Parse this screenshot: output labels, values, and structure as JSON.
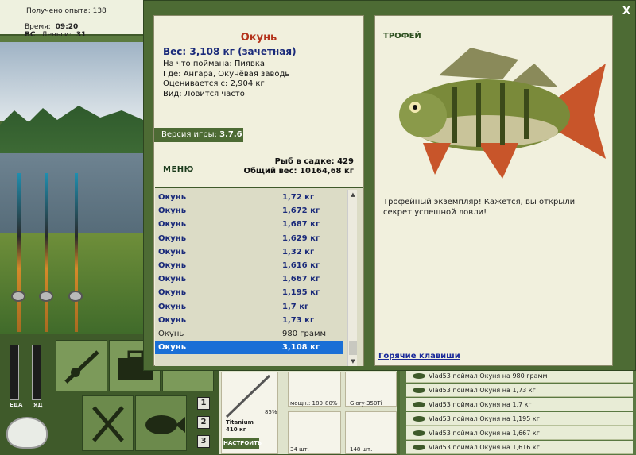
{
  "topbar": {
    "experience": "Получено опыта: 138",
    "time_label": "Время:",
    "time_value": "09:20 ВС",
    "money_label": "Деньги:",
    "money_value": "31"
  },
  "left_panel": {
    "bar1_label": "ЕДА",
    "bar2_label": "ЯД",
    "num_buttons": [
      "1",
      "2",
      "3"
    ]
  },
  "gear": {
    "rod_name": "Titanium",
    "rod_weight": "410 кг",
    "rod_pct": "85%",
    "reel_power": "мощн.: 180",
    "reel_pct": "80%",
    "line_name": "Glory-350Ti",
    "hooks_count": "34 шт.",
    "bait_count": "148 шт.",
    "setup_button": "НАСТРОИТЬ"
  },
  "log": {
    "lines": [
      "Vlad53 поймал Окуня на 980 грамм",
      "Vlad53 поймал Окуня на 1,73 кг",
      "Vlad53 поймал Окуня на 1,7 кг",
      "Vlad53 поймал Окуня на 1,195 кг",
      "Vlad53 поймал Окуня на 1,667 кг",
      "Vlad53 поймал Окуня на 1,616 кг"
    ]
  },
  "dialog": {
    "close": "X",
    "fish_name": "Окунь",
    "weight": "Вес: 3,108 кг (зачетная)",
    "caught_on": "На что поймана: Пиявка",
    "where": "Где: Ангара, Окунёвая заводь",
    "valued_from": "Оценивается с: 2,904 кг",
    "kind": "Вид: Ловится часто",
    "version_label": "Версия игры: ",
    "version_value": "3.7.6",
    "menu": "МЕНЮ",
    "fish_in_net": "Рыб в садке: 429",
    "total_weight": "Общий вес: 10164,68 кг",
    "catch_list": [
      {
        "name": "Окунь",
        "weight": "1,72 кг",
        "style": "bold"
      },
      {
        "name": "Окунь",
        "weight": "1,672 кг",
        "style": "bold"
      },
      {
        "name": "Окунь",
        "weight": "1,687 кг",
        "style": "bold"
      },
      {
        "name": "Окунь",
        "weight": "1,629 кг",
        "style": "bold"
      },
      {
        "name": "Окунь",
        "weight": "1,32 кг",
        "style": "bold"
      },
      {
        "name": "Окунь",
        "weight": "1,616 кг",
        "style": "bold"
      },
      {
        "name": "Окунь",
        "weight": "1,667 кг",
        "style": "bold"
      },
      {
        "name": "Окунь",
        "weight": "1,195 кг",
        "style": "bold"
      },
      {
        "name": "Окунь",
        "weight": "1,7 кг",
        "style": "bold"
      },
      {
        "name": "Окунь",
        "weight": "1,73 кг",
        "style": "bold"
      },
      {
        "name": "Окунь",
        "weight": "980 грамм",
        "style": "plain"
      },
      {
        "name": "Окунь",
        "weight": "3,108 кг",
        "style": "sel"
      }
    ],
    "trophy_label": "ТРОФЕЙ",
    "trophy_text": "Трофейный экземпляр! Кажется, вы открыли секрет успешной ловли!",
    "hotkeys": "Горячие клавиши"
  }
}
